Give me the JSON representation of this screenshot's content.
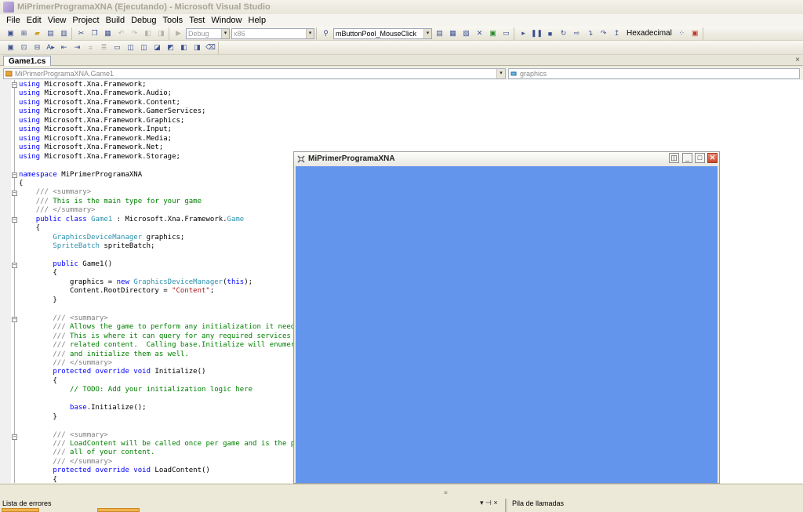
{
  "window": {
    "title": "MiPrimerProgramaXNA (Ejecutando) - Microsoft Visual Studio"
  },
  "menu": [
    "File",
    "Edit",
    "View",
    "Project",
    "Build",
    "Debug",
    "Tools",
    "Test",
    "Window",
    "Help"
  ],
  "toolbar": {
    "config_combo": "Debug",
    "platform_combo": "x86",
    "find_combo": "mButtonPool_MouseClick",
    "hex_label": "Hexadecimal"
  },
  "tabs": {
    "active": "Game1.cs",
    "close_glyph": "×"
  },
  "nav": {
    "type_combo": "MiPrimerProgramaXNA.Game1",
    "member_combo": "graphics"
  },
  "code": [
    [
      [
        "kw",
        "using "
      ],
      [
        "t",
        "Microsoft.Xna.Framework;"
      ]
    ],
    [
      [
        "kw",
        "using "
      ],
      [
        "t",
        "Microsoft.Xna.Framework.Audio;"
      ]
    ],
    [
      [
        "kw",
        "using "
      ],
      [
        "t",
        "Microsoft.Xna.Framework.Content;"
      ]
    ],
    [
      [
        "kw",
        "using "
      ],
      [
        "t",
        "Microsoft.Xna.Framework.GamerServices;"
      ]
    ],
    [
      [
        "kw",
        "using "
      ],
      [
        "t",
        "Microsoft.Xna.Framework.Graphics;"
      ]
    ],
    [
      [
        "kw",
        "using "
      ],
      [
        "t",
        "Microsoft.Xna.Framework.Input;"
      ]
    ],
    [
      [
        "kw",
        "using "
      ],
      [
        "t",
        "Microsoft.Xna.Framework.Media;"
      ]
    ],
    [
      [
        "kw",
        "using "
      ],
      [
        "t",
        "Microsoft.Xna.Framework.Net;"
      ]
    ],
    [
      [
        "kw",
        "using "
      ],
      [
        "t",
        "Microsoft.Xna.Framework.Storage;"
      ]
    ],
    [],
    [
      [
        "kw",
        "namespace "
      ],
      [
        "t",
        "MiPrimerProgramaXNA"
      ]
    ],
    [
      [
        "t",
        "{"
      ]
    ],
    [
      [
        "t",
        "    "
      ],
      [
        "xd",
        "/// <summary>"
      ]
    ],
    [
      [
        "t",
        "    "
      ],
      [
        "xd",
        "/// "
      ],
      [
        "cm",
        "This is the main type for your game"
      ]
    ],
    [
      [
        "t",
        "    "
      ],
      [
        "xd",
        "/// </summary>"
      ]
    ],
    [
      [
        "t",
        "    "
      ],
      [
        "kw",
        "public class "
      ],
      [
        "ty",
        "Game1"
      ],
      [
        "t",
        " : Microsoft.Xna.Framework."
      ],
      [
        "ty",
        "Game"
      ]
    ],
    [
      [
        "t",
        "    {"
      ]
    ],
    [
      [
        "t",
        "        "
      ],
      [
        "ty",
        "GraphicsDeviceManager"
      ],
      [
        "t",
        " graphics;"
      ]
    ],
    [
      [
        "t",
        "        "
      ],
      [
        "ty",
        "SpriteBatch"
      ],
      [
        "t",
        " spriteBatch;"
      ]
    ],
    [],
    [
      [
        "t",
        "        "
      ],
      [
        "kw",
        "public "
      ],
      [
        "t",
        "Game1()"
      ]
    ],
    [
      [
        "t",
        "        {"
      ]
    ],
    [
      [
        "t",
        "            graphics = "
      ],
      [
        "kw",
        "new "
      ],
      [
        "ty",
        "GraphicsDeviceManager"
      ],
      [
        "t",
        "("
      ],
      [
        "kw",
        "this"
      ],
      [
        "t",
        ");"
      ]
    ],
    [
      [
        "t",
        "            Content.RootDirectory = "
      ],
      [
        "st",
        "\"Content\""
      ],
      [
        "t",
        ";"
      ]
    ],
    [
      [
        "t",
        "        }"
      ]
    ],
    [],
    [
      [
        "t",
        "        "
      ],
      [
        "xd",
        "/// <summary>"
      ]
    ],
    [
      [
        "t",
        "        "
      ],
      [
        "xd",
        "/// "
      ],
      [
        "cm",
        "Allows the game to perform any initialization it need"
      ]
    ],
    [
      [
        "t",
        "        "
      ],
      [
        "xd",
        "/// "
      ],
      [
        "cm",
        "This is where it can query for any required services"
      ]
    ],
    [
      [
        "t",
        "        "
      ],
      [
        "xd",
        "/// "
      ],
      [
        "cm",
        "related content.  Calling base.Initialize will enumer"
      ]
    ],
    [
      [
        "t",
        "        "
      ],
      [
        "xd",
        "/// "
      ],
      [
        "cm",
        "and initialize them as well."
      ]
    ],
    [
      [
        "t",
        "        "
      ],
      [
        "xd",
        "/// </summary>"
      ]
    ],
    [
      [
        "t",
        "        "
      ],
      [
        "kw",
        "protected override void "
      ],
      [
        "t",
        "Initialize()"
      ]
    ],
    [
      [
        "t",
        "        {"
      ]
    ],
    [
      [
        "t",
        "            "
      ],
      [
        "cm",
        "// TODO: Add your initialization logic here"
      ]
    ],
    [],
    [
      [
        "t",
        "            "
      ],
      [
        "kw",
        "base"
      ],
      [
        "t",
        ".Initialize();"
      ]
    ],
    [
      [
        "t",
        "        }"
      ]
    ],
    [],
    [
      [
        "t",
        "        "
      ],
      [
        "xd",
        "/// <summary>"
      ]
    ],
    [
      [
        "t",
        "        "
      ],
      [
        "xd",
        "/// "
      ],
      [
        "cm",
        "LoadContent will be called once per game and is the p"
      ]
    ],
    [
      [
        "t",
        "        "
      ],
      [
        "xd",
        "/// "
      ],
      [
        "cm",
        "all of your content."
      ]
    ],
    [
      [
        "t",
        "        "
      ],
      [
        "xd",
        "/// </summary>"
      ]
    ],
    [
      [
        "t",
        "        "
      ],
      [
        "kw",
        "protected override void "
      ],
      [
        "t",
        "LoadContent()"
      ]
    ],
    [
      [
        "t",
        "        {"
      ]
    ]
  ],
  "game_window": {
    "title": "MiPrimerProgramaXNA",
    "canvas_color": "#6495ED"
  },
  "panels": {
    "error_list": "Lista de errores",
    "call_stack": "Pila de llamadas",
    "controls": "▾ ⊣ ×"
  }
}
